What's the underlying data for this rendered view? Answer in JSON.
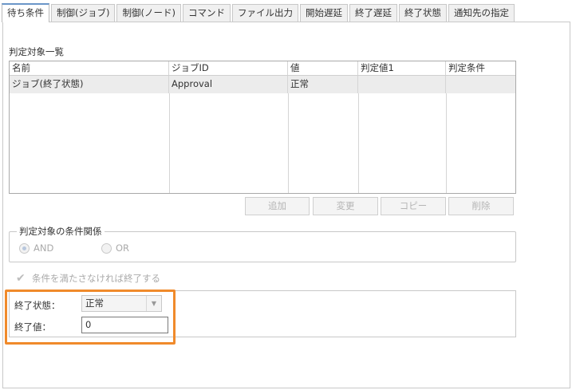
{
  "tabs": [
    "待ち条件",
    "制御(ジョブ)",
    "制御(ノード)",
    "コマンド",
    "ファイル出力",
    "開始遅延",
    "終了遅延",
    "終了状態",
    "通知先の指定"
  ],
  "section_title": "判定対象一覧",
  "table": {
    "columns": [
      "名前",
      "ジョブID",
      "値",
      "判定値1",
      "判定条件"
    ],
    "rows": [
      [
        "ジョブ(終了状態)",
        "Approval",
        "正常",
        "",
        ""
      ]
    ]
  },
  "buttons": {
    "add": "追加",
    "modify": "変更",
    "copy": "コピー",
    "delete": "削除"
  },
  "condition_group": {
    "title": "判定対象の条件関係",
    "and_label": "AND",
    "or_label": "OR",
    "selected": "AND"
  },
  "checkbox_label": "条件を満たさなければ終了する",
  "end_status": {
    "label": "終了状態：",
    "value": "正常"
  },
  "end_value": {
    "label": "終了値：",
    "value": "0"
  },
  "colors": {
    "highlight": "#f08a2b",
    "active_tab_accent": "#6a96c8"
  }
}
